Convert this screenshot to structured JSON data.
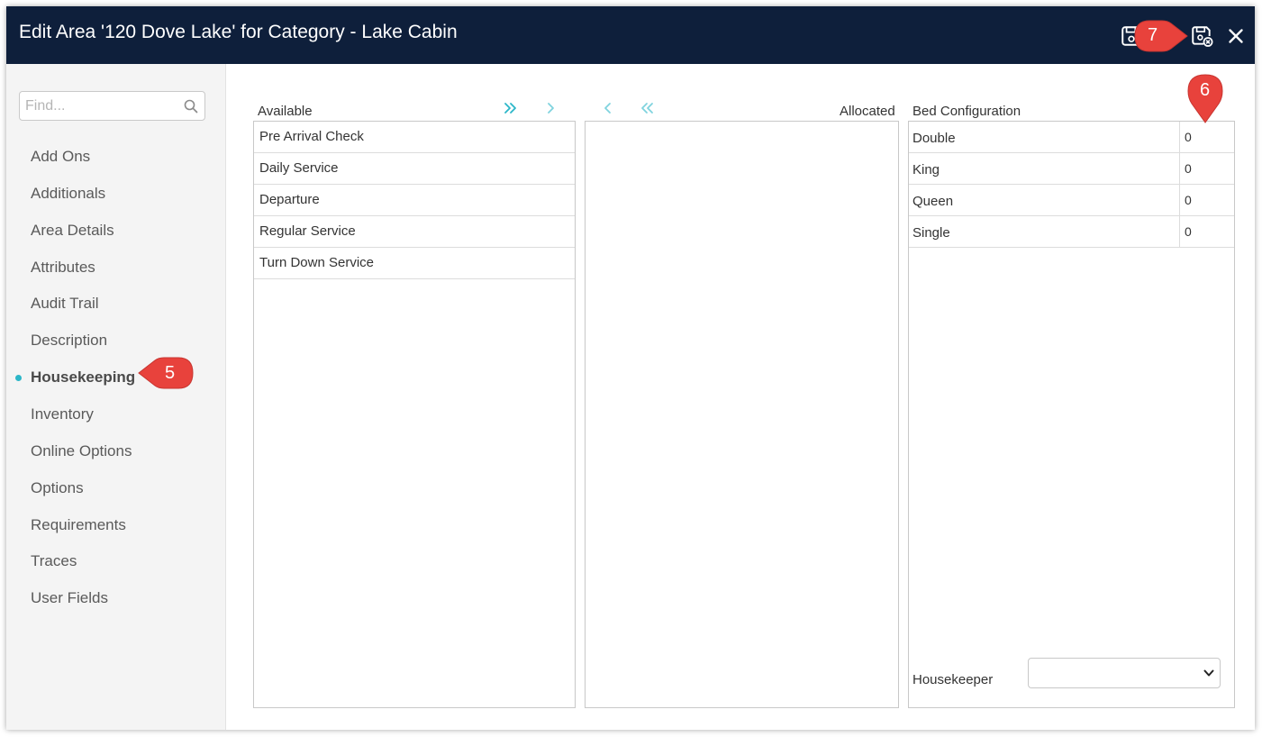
{
  "window": {
    "title": "Edit Area '120 Dove Lake' for Category - Lake Cabin",
    "title_bg": "#0e1f3b"
  },
  "toolbar": {
    "icons": [
      "save-icon",
      "save-and-close-icon",
      "close-icon"
    ]
  },
  "sidebar": {
    "search_placeholder": "Find...",
    "items": [
      {
        "label": "Add Ons"
      },
      {
        "label": "Additionals"
      },
      {
        "label": "Area Details"
      },
      {
        "label": "Attributes"
      },
      {
        "label": "Audit Trail"
      },
      {
        "label": "Description"
      },
      {
        "label": "Housekeeping",
        "active": true
      },
      {
        "label": "Inventory"
      },
      {
        "label": "Online Options"
      },
      {
        "label": "Options"
      },
      {
        "label": "Requirements"
      },
      {
        "label": "Traces"
      },
      {
        "label": "User Fields"
      }
    ],
    "active_color": "#2bb6c8"
  },
  "available": {
    "label": "Available",
    "items": [
      "Pre Arrival Check",
      "Daily Service",
      "Departure",
      "Regular Service",
      "Turn Down Service"
    ]
  },
  "allocated": {
    "label": "Allocated",
    "items": []
  },
  "transfer_buttons": [
    "move-all-right-icon",
    "move-right-icon",
    "move-left-icon",
    "move-all-left-icon"
  ],
  "bed_configuration": {
    "label": "Bed Configuration",
    "rows": [
      {
        "name": "Double",
        "value": "0"
      },
      {
        "name": "King",
        "value": "0"
      },
      {
        "name": "Queen",
        "value": "0"
      },
      {
        "name": "Single",
        "value": "0"
      }
    ]
  },
  "housekeeper": {
    "label": "Housekeeper",
    "value": ""
  },
  "callouts": [
    "5",
    "6",
    "7"
  ],
  "callout_color": "#e8423c"
}
